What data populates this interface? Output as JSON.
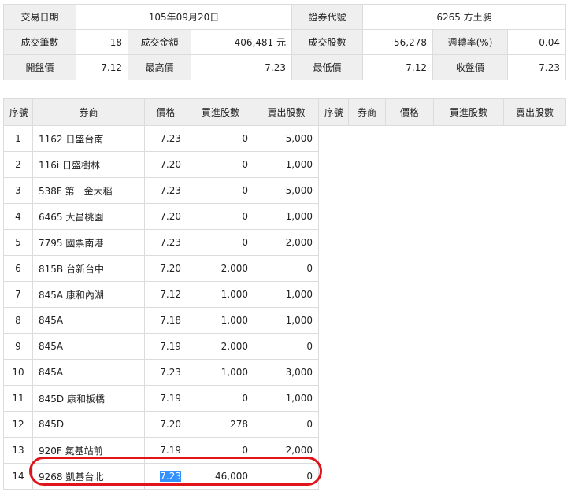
{
  "summary": {
    "trade_date_label": "交易日期",
    "trade_date": "105年09月20日",
    "security_code_label": "證券代號",
    "security_code": "6265 方土昶",
    "trade_count_label": "成交筆數",
    "trade_count": "18",
    "trade_amount_label": "成交金額",
    "trade_amount": "406,481 元",
    "trade_shares_label": "成交股數",
    "trade_shares": "56,278",
    "turnover_label": "週轉率(%)",
    "turnover": "0.04",
    "open_label": "開盤價",
    "open": "7.12",
    "high_label": "最高價",
    "high": "7.23",
    "low_label": "最低價",
    "low": "7.12",
    "close_label": "收盤價",
    "close": "7.23"
  },
  "table": {
    "headers": [
      "序號",
      "券商",
      "價格",
      "買進股數",
      "賣出股數",
      "序號",
      "券商",
      "價格",
      "買進股數",
      "賣出股數"
    ],
    "rows": [
      [
        "1",
        "1162 日盛台南",
        "7.23",
        "0",
        "5,000"
      ],
      [
        "2",
        "116i 日盛樹林",
        "7.20",
        "0",
        "1,000"
      ],
      [
        "3",
        "538F 第一金大稻",
        "7.23",
        "0",
        "5,000"
      ],
      [
        "4",
        "6465 大昌桃園",
        "7.20",
        "0",
        "1,000"
      ],
      [
        "5",
        "7795 國票南港",
        "7.23",
        "0",
        "2,000"
      ],
      [
        "6",
        "815B 台新台中",
        "7.20",
        "2,000",
        "0"
      ],
      [
        "7",
        "845A 康和內湖",
        "7.12",
        "1,000",
        "1,000"
      ],
      [
        "8",
        "845A",
        "7.18",
        "1,000",
        "1,000"
      ],
      [
        "9",
        "845A",
        "7.19",
        "2,000",
        "0"
      ],
      [
        "10",
        "845A",
        "7.23",
        "1,000",
        "3,000"
      ],
      [
        "11",
        "845D 康和板橋",
        "7.19",
        "0",
        "1,000"
      ],
      [
        "12",
        "845D",
        "7.20",
        "278",
        "0"
      ],
      [
        "13",
        "920F 氣基站前",
        "7.19",
        "0",
        "2,000"
      ],
      [
        "14",
        "9268 凱基台北",
        "7.23",
        "46,000",
        "0"
      ]
    ]
  }
}
